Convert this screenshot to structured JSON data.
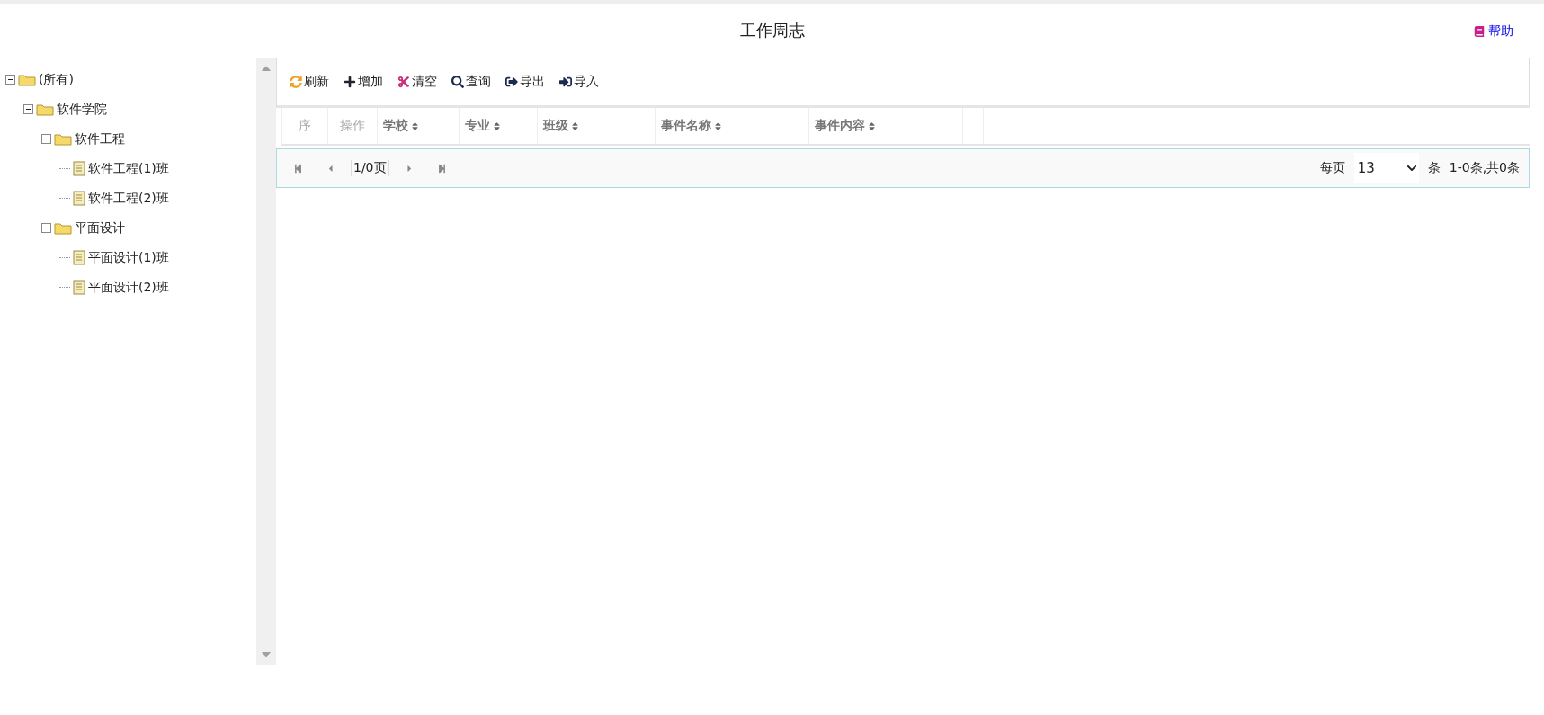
{
  "title": "工作周志",
  "help_link": "帮助",
  "tree": [
    {
      "label": "(所有)",
      "kind": "folder",
      "expanded": true,
      "children": [
        {
          "label": "软件学院",
          "kind": "folder",
          "expanded": true,
          "children": [
            {
              "label": "软件工程",
              "kind": "folder",
              "expanded": true,
              "children": [
                {
                  "label": "软件工程(1)班",
                  "kind": "file"
                },
                {
                  "label": "软件工程(2)班",
                  "kind": "file"
                }
              ]
            },
            {
              "label": "平面设计",
              "kind": "folder",
              "expanded": true,
              "children": [
                {
                  "label": "平面设计(1)班",
                  "kind": "file"
                },
                {
                  "label": "平面设计(2)班",
                  "kind": "file"
                }
              ]
            }
          ]
        }
      ]
    }
  ],
  "toolbar": [
    {
      "label": "刷新",
      "kind": "refresh"
    },
    {
      "label": "增加",
      "kind": "add"
    },
    {
      "label": "清空",
      "kind": "clear"
    },
    {
      "label": "查询",
      "kind": "search"
    },
    {
      "label": "导出",
      "kind": "export"
    },
    {
      "label": "导入",
      "kind": "import"
    }
  ],
  "table": {
    "columns": [
      {
        "label": "序",
        "sortable": false
      },
      {
        "label": "操作",
        "sortable": false
      },
      {
        "label": "学校",
        "sortable": true
      },
      {
        "label": "专业",
        "sortable": true
      },
      {
        "label": "班级",
        "sortable": true
      },
      {
        "label": "事件名称",
        "sortable": true
      },
      {
        "label": "事件内容",
        "sortable": true
      }
    ]
  },
  "pager": {
    "page": "1/0页",
    "per_page_label": "每页",
    "per_page": "13",
    "unit": "条",
    "summary": "1-0条,共0条"
  }
}
